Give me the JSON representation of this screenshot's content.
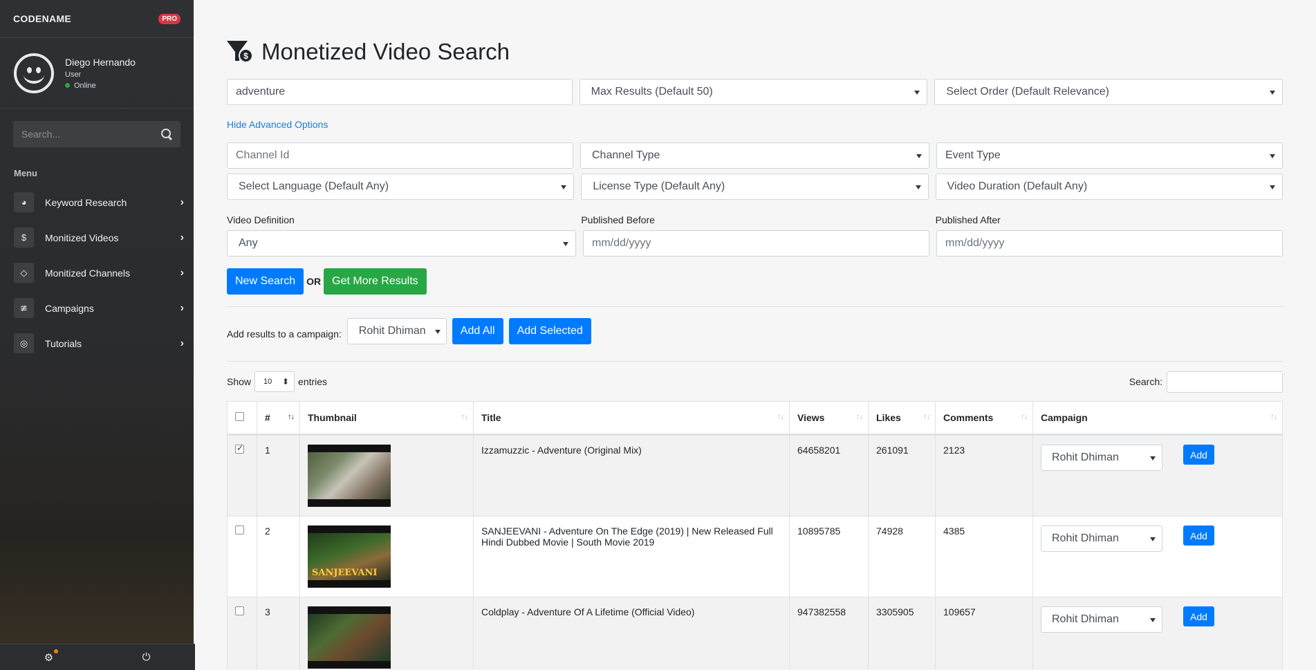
{
  "sidebar": {
    "brand": "CODENAME",
    "badge": "PRO",
    "user": {
      "name": "Diego Hernando",
      "role": "User",
      "status": "Online"
    },
    "search_placeholder": "Search...",
    "menu_title": "Menu",
    "items": [
      {
        "label": "Keyword Research",
        "icon": "dashboard-icon"
      },
      {
        "label": "Monitized Videos",
        "icon": "dollar-icon"
      },
      {
        "label": "Monitized Channels",
        "icon": "diamond-icon"
      },
      {
        "label": "Campaigns",
        "icon": "chart-icon"
      },
      {
        "label": "Tutorials",
        "icon": "globe-icon"
      }
    ]
  },
  "page": {
    "title": "Monetized Video Search",
    "query": "adventure",
    "max_results": "Max Results (Default 50)",
    "order": "Select Order (Default Relevance)",
    "toggle_link": "Hide Advanced Options",
    "channel_id_placeholder": "Channel Id",
    "channel_type": "Channel Type",
    "event_type": "Event Type",
    "language": "Select Language (Default Any)",
    "license": "License Type (Default Any)",
    "duration": "Video Duration (Default Any)",
    "definition_label": "Video Definition",
    "definition_value": "Any",
    "published_before_label": "Published Before",
    "published_before_placeholder": "mm/dd/yyyy",
    "published_after_label": "Published After",
    "published_after_placeholder": "mm/dd/yyyy",
    "new_search": "New Search",
    "or": "OR",
    "more_results": "Get More Results",
    "campaign_label": "Add results to a campaign:",
    "campaign_value": "Rohit Dhiman",
    "add_all": "Add All",
    "add_selected": "Add Selected"
  },
  "table": {
    "show": "Show",
    "length": "10",
    "entries": "entries",
    "search_label": "Search:",
    "columns": [
      "#",
      "Thumbnail",
      "Title",
      "Views",
      "Likes",
      "Comments",
      "Campaign"
    ],
    "rows": [
      {
        "num": "1",
        "title": "Izzamuzzic - Adventure (Original Mix)",
        "views": "64658201",
        "likes": "261091",
        "comments": "2123",
        "campaign": "Rohit Dhiman",
        "add": "Add",
        "checked": true
      },
      {
        "num": "2",
        "title": "SANJEEVANI - Adventure On The Edge (2019) | New Released Full Hindi Dubbed Movie | South Movie 2019",
        "views": "10895785",
        "likes": "74928",
        "comments": "4385",
        "campaign": "Rohit Dhiman",
        "add": "Add",
        "checked": false,
        "thumb_text": "SANJEEVANI"
      },
      {
        "num": "3",
        "title": "Coldplay - Adventure Of A Lifetime (Official Video)",
        "views": "947382558",
        "likes": "3305905",
        "comments": "109657",
        "campaign": "Rohit Dhiman",
        "add": "Add",
        "checked": false
      }
    ]
  }
}
